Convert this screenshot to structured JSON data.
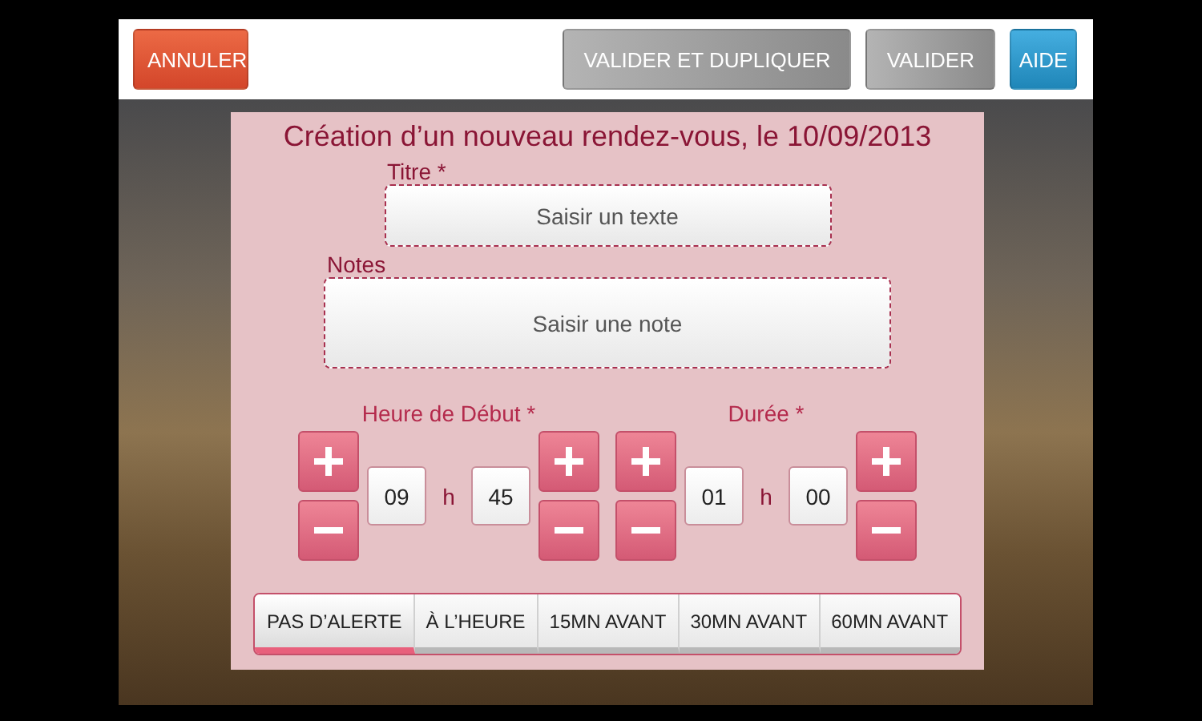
{
  "toolbar": {
    "buttons": [
      {
        "label": "ANNULER",
        "kind": "cancel"
      },
      {
        "label": "VALIDER ET DUPLIQUER",
        "kind": "secondary"
      },
      {
        "label": "VALIDER",
        "kind": "secondary"
      },
      {
        "label": "AIDE",
        "kind": "help"
      }
    ]
  },
  "dialog": {
    "title": "Création d’un nouveau rendez-vous, le 10/09/2013",
    "fields": [
      {
        "label": "Titre *",
        "placeholder": "Saisir un texte",
        "kind": "short"
      },
      {
        "label": "Notes",
        "placeholder": "Saisir une note",
        "kind": "tall"
      }
    ],
    "time_pickers": [
      {
        "label": "Heure de Début *",
        "hours": "09",
        "separator": "h",
        "minutes": "45"
      },
      {
        "label": "Durée *",
        "hours": "01",
        "separator": "h",
        "minutes": "00"
      }
    ],
    "alerts": [
      {
        "label": "PAS D’ALERTE",
        "selected": true
      },
      {
        "label": "À L’HEURE",
        "selected": false
      },
      {
        "label": "15MN AVANT",
        "selected": false
      },
      {
        "label": "30MN AVANT",
        "selected": false
      },
      {
        "label": "60MN AVANT",
        "selected": false
      }
    ]
  }
}
